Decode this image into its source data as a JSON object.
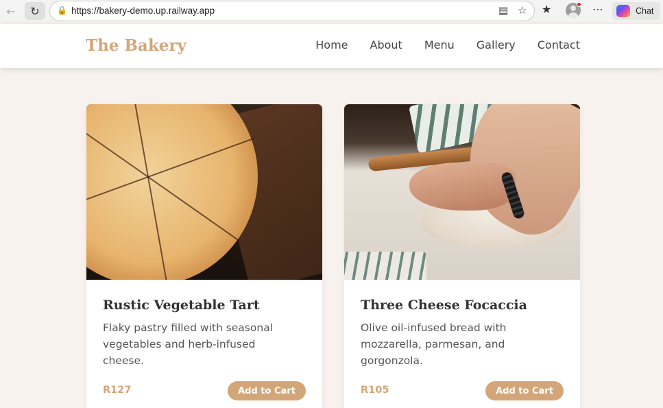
{
  "browser": {
    "url": "https://bakery-demo.up.railway.app",
    "chat_label": "Chat",
    "icons": [
      "back-arrow-icon",
      "reload-icon",
      "lock-icon",
      "reading-view-icon",
      "favorite-star-icon",
      "favorites-icon",
      "profile-icon",
      "more-icon",
      "copilot-icon"
    ]
  },
  "site": {
    "brand": "The Bakery",
    "nav": [
      {
        "label": "Home"
      },
      {
        "label": "About"
      },
      {
        "label": "Menu"
      },
      {
        "label": "Gallery"
      },
      {
        "label": "Contact"
      }
    ]
  },
  "products": [
    {
      "title": "Rustic Vegetable Tart",
      "description": "Flaky pastry filled with seasonal vegetables and herb-infused cheese.",
      "price": "R127",
      "button": "Add to Cart"
    },
    {
      "title": "Three Cheese Focaccia",
      "description": "Olive oil-infused bread with mozzarella, parmesan, and gorgonzola.",
      "price": "R105",
      "button": "Add to Cart"
    }
  ],
  "colors": {
    "accent": "#d2a679",
    "page_bg": "#f7f2ee",
    "text": "#444444"
  }
}
